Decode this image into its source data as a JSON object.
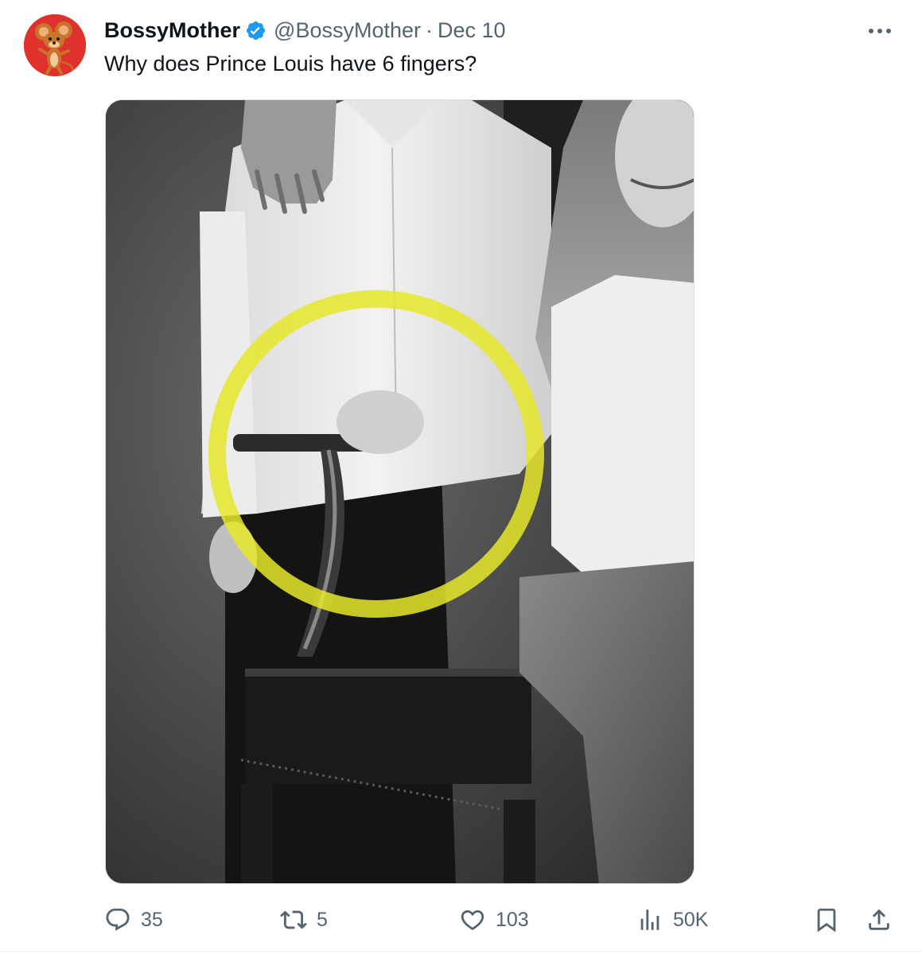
{
  "author": {
    "display_name": "BossyMother",
    "handle": "@BossyMother",
    "separator": "·",
    "date": "Dec 10",
    "verified": true,
    "avatar_icon": "cartoon-mouse-avatar"
  },
  "tweet": {
    "text": "Why does Prince Louis have 6 fingers?"
  },
  "media": {
    "kind": "photo",
    "highlight_color": "#e6e62a"
  },
  "actions": {
    "reply_count": "35",
    "retweet_count": "5",
    "like_count": "103",
    "views_count": "50K"
  },
  "colors": {
    "verified_badge": "#1d9bf0",
    "secondary_text": "#536471",
    "primary_text": "#0f1419",
    "avatar_bg": "#e0322c"
  }
}
